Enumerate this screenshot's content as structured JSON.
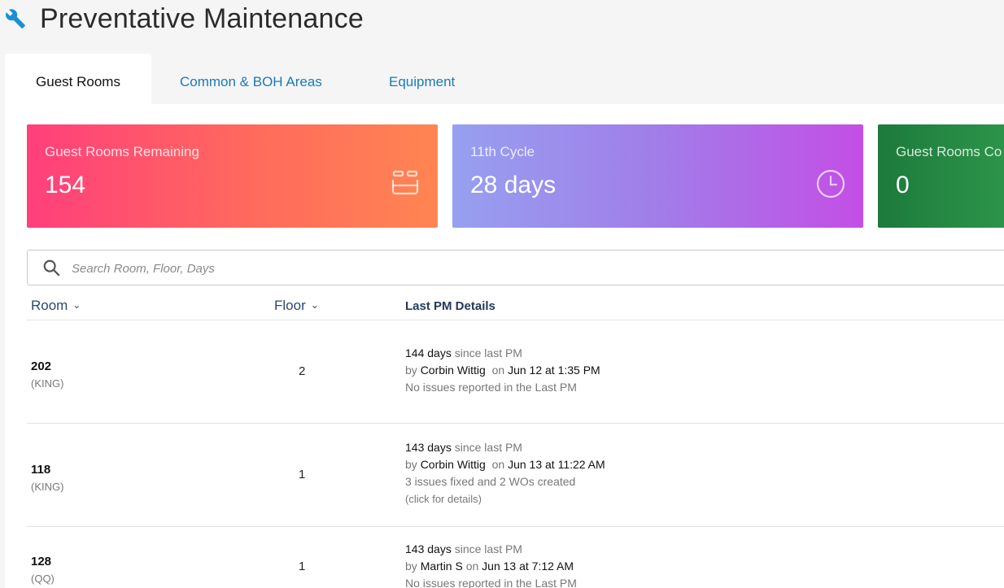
{
  "header": {
    "title": "Preventative Maintenance",
    "icon": "wrench-icon"
  },
  "tabs": [
    {
      "label": "Guest Rooms",
      "active": true
    },
    {
      "label": "Common & BOH Areas",
      "active": false
    },
    {
      "label": "Equipment",
      "active": false
    }
  ],
  "cards": [
    {
      "label": "Guest Rooms Remaining",
      "value": "154",
      "icon": "bed-icon"
    },
    {
      "label": "11th Cycle",
      "value": "28 days",
      "icon": "clock-icon"
    },
    {
      "label": "Guest Rooms Co",
      "value": "0"
    }
  ],
  "search": {
    "placeholder": "Search Room, Floor, Days",
    "value": ""
  },
  "table": {
    "headers": {
      "room": "Room",
      "floor": "Floor",
      "last_pm": "Last PM Details"
    },
    "rows": [
      {
        "room": "202",
        "type": "(KING)",
        "floor": "2",
        "days": "144 days",
        "since": "since last PM",
        "by": "by",
        "user": "Corbin Wittig",
        "on": "on",
        "date": "Jun 12 at 1:35 PM",
        "status": "No issues reported in the Last PM",
        "note": ""
      },
      {
        "room": "118",
        "type": "(KING)",
        "floor": "1",
        "days": "143 days",
        "since": "since last PM",
        "by": "by",
        "user": "Corbin Wittig",
        "on": "on",
        "date": "Jun 13 at 11:22 AM",
        "status": "3 issues fixed and 2 WOs created",
        "note": "(click for details)"
      },
      {
        "room": "128",
        "type": "(QQ)",
        "floor": "1",
        "days": "143 days",
        "since": "since last PM",
        "by": "by",
        "user": "Martin S",
        "on": "on",
        "date": "Jun 13 at 7:12 AM",
        "status": "No issues reported in the Last PM",
        "note": ""
      }
    ]
  },
  "colors": {
    "accent": "#1a7bb5",
    "header_text": "#23395d"
  }
}
